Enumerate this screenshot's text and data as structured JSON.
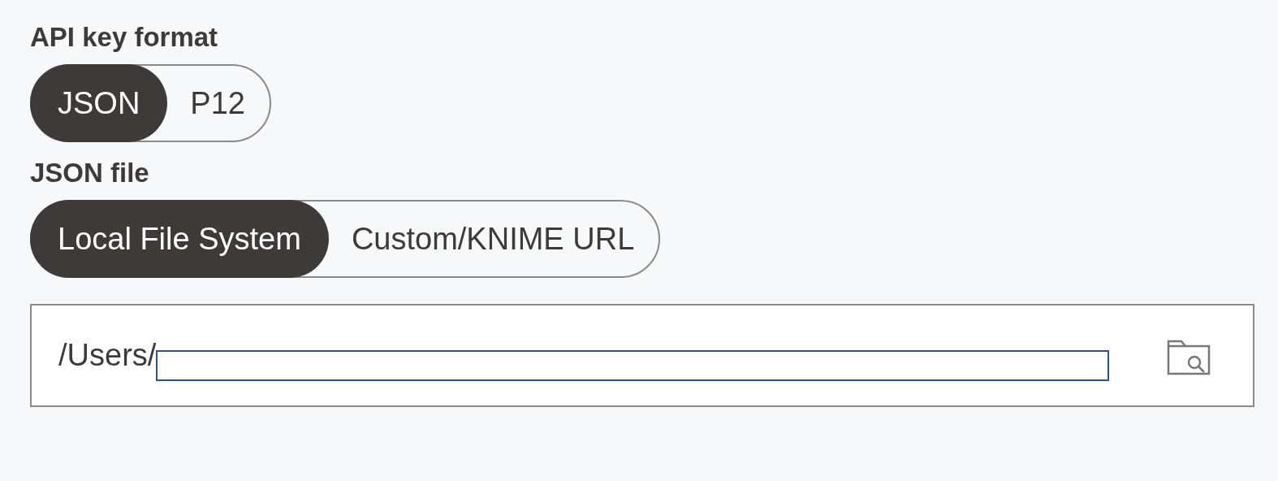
{
  "sections": [
    {
      "label": "API key format",
      "options": [
        {
          "label": "JSON",
          "selected": true
        },
        {
          "label": "P12",
          "selected": false
        }
      ]
    },
    {
      "label": "JSON file",
      "options": [
        {
          "label": "Local File System",
          "selected": true
        },
        {
          "label": "Custom/KNIME URL",
          "selected": false
        }
      ]
    }
  ],
  "path_field": {
    "value": "/Users/",
    "redacted": true
  }
}
